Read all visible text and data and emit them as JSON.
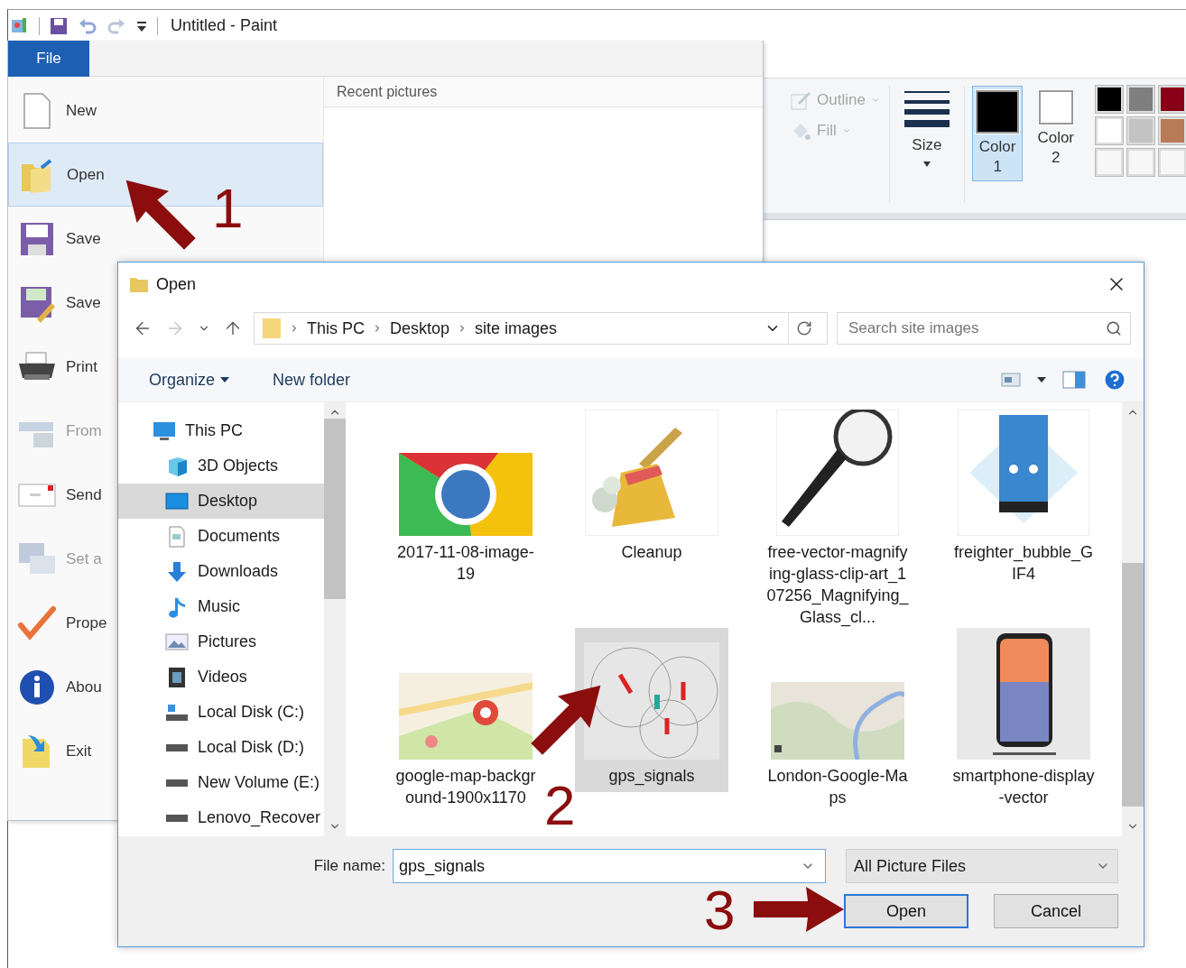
{
  "paint": {
    "title": "Untitled - Paint",
    "ribbon": {
      "shape_options": [
        {
          "kind": "outline",
          "label": "Outline",
          "disabled": true
        },
        {
          "kind": "fill",
          "label": "Fill",
          "disabled": true
        }
      ],
      "size_label": "Size",
      "colors": [
        {
          "label": "Color 1",
          "color": "#000000",
          "selected": true
        },
        {
          "label": "Color 2",
          "color": "#ffffff",
          "selected": false
        }
      ],
      "palette": [
        {
          "color": "#000000"
        },
        {
          "color": "#7f7f7f"
        },
        {
          "color": "#880015"
        },
        {
          "color": "#ffffff"
        },
        {
          "color": "#c3c3c3"
        },
        {
          "color": "#b97a57"
        }
      ]
    }
  },
  "file_menu": {
    "tab": "File",
    "recent_title": "Recent pictures",
    "items": [
      {
        "kind": "new",
        "label": "New",
        "selected": false,
        "disabled": false
      },
      {
        "kind": "open",
        "label": "Open",
        "selected": true,
        "disabled": false
      },
      {
        "kind": "save",
        "label": "Save",
        "selected": false,
        "disabled": false
      },
      {
        "kind": "save-as",
        "label": "Save",
        "selected": false,
        "disabled": false
      },
      {
        "kind": "print",
        "label": "Print",
        "selected": false,
        "disabled": false
      },
      {
        "kind": "scanner",
        "label": "From",
        "selected": false,
        "disabled": true
      },
      {
        "kind": "email",
        "label": "Send",
        "selected": false,
        "disabled": false
      },
      {
        "kind": "wallpaper",
        "label": "Set a",
        "selected": false,
        "disabled": true
      },
      {
        "kind": "properties",
        "label": "Prope",
        "selected": false,
        "disabled": false
      },
      {
        "kind": "about",
        "label": "Abou",
        "selected": false,
        "disabled": false
      },
      {
        "kind": "exit",
        "label": "Exit",
        "selected": false,
        "disabled": false
      }
    ]
  },
  "dialog": {
    "title": "Open",
    "navigation": {
      "back_enabled": true,
      "forward_enabled": false
    },
    "path": [
      "This PC",
      "Desktop",
      "site images"
    ],
    "search": {
      "placeholder": "Search site images"
    },
    "toolbar": [
      {
        "label": "Organize",
        "has_menu": true
      },
      {
        "label": "New folder",
        "has_menu": false
      }
    ],
    "tree": [
      {
        "kind": "computer",
        "label": "This PC",
        "selected": false,
        "children": [
          {
            "kind": "cube",
            "label": "3D Objects",
            "selected": false
          },
          {
            "kind": "desktop",
            "label": "Desktop",
            "selected": true
          },
          {
            "kind": "document",
            "label": "Documents",
            "selected": false
          },
          {
            "kind": "download",
            "label": "Downloads",
            "selected": false
          },
          {
            "kind": "music",
            "label": "Music",
            "selected": false
          },
          {
            "kind": "pictures",
            "label": "Pictures",
            "selected": false
          },
          {
            "kind": "video",
            "label": "Videos",
            "selected": false
          },
          {
            "kind": "system-drive",
            "label": "Local Disk (C:)",
            "selected": false
          },
          {
            "kind": "drive",
            "label": "Local Disk (D:)",
            "selected": false
          },
          {
            "kind": "drive",
            "label": "New Volume (E:)",
            "selected": false
          },
          {
            "kind": "drive",
            "label": "Lenovo_Recover",
            "selected": false
          }
        ]
      }
    ],
    "files": [
      {
        "name": "2017-11-08-image-19",
        "selected": false
      },
      {
        "name": "Cleanup",
        "selected": false
      },
      {
        "name": "free-vector-magnifying-glass-clip-art_107256_Magnifying_Glass_cl...",
        "selected": false
      },
      {
        "name": "freighter_bubble_GIF4",
        "selected": false
      },
      {
        "name": "google-map-background-1900x1170",
        "selected": false
      },
      {
        "name": "gps_signals",
        "selected": true
      },
      {
        "name": "London-Google-Maps",
        "selected": false
      },
      {
        "name": "smartphone-display-vector",
        "selected": false
      }
    ],
    "file_name_label": "File name:",
    "file_name": "gps_signals",
    "filter": "All Picture Files",
    "buttons": [
      {
        "label": "Open",
        "default": true
      },
      {
        "label": "Cancel",
        "default": false
      }
    ]
  },
  "annotations": [
    {
      "label": "1"
    },
    {
      "label": "2"
    },
    {
      "label": "3"
    }
  ]
}
